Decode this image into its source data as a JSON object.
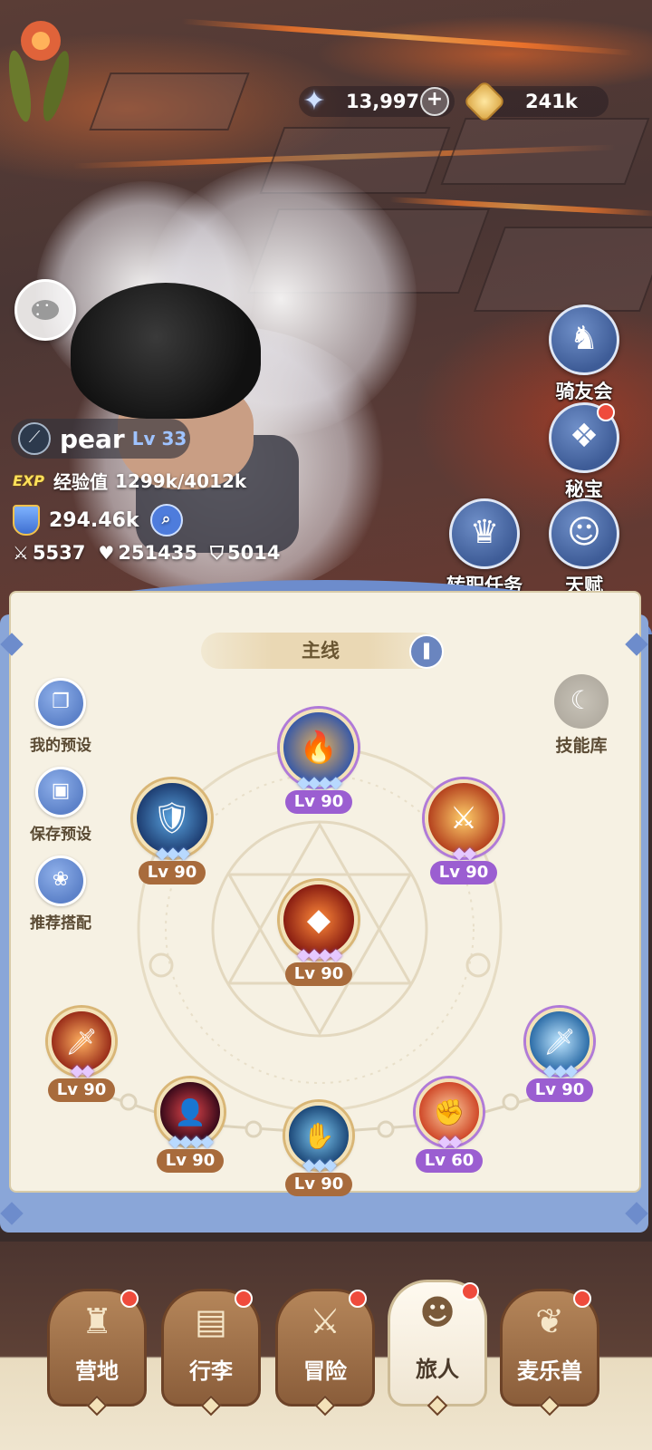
{
  "currency": {
    "gems": "13,997",
    "coins": "241k"
  },
  "player": {
    "name": "pear",
    "level": "Lv 33",
    "exp_badge": "EXP",
    "exp_label": "经验值",
    "exp_value": "1299k/4012k",
    "power": "294.46k",
    "attack": "5537",
    "hp": "251435",
    "defense": "5014"
  },
  "right_menu": {
    "mount_club": "骑友会",
    "treasure": "秘宝",
    "job_change": "转职任务",
    "talent": "天赋"
  },
  "panel": {
    "tab": "主线",
    "my_preset": "我的预设",
    "save_preset": "保存预设",
    "recommended": "推荐搭配",
    "skill_library": "技能库"
  },
  "skills": [
    {
      "id": "top",
      "level": "Lv 90",
      "stars": "◆◆◆◆",
      "icon": "🔥"
    },
    {
      "id": "upper-left",
      "level": "Lv 90",
      "stars": "◆◆◆",
      "icon": "🛡"
    },
    {
      "id": "upper-right",
      "level": "Lv 90",
      "stars": "◆◆",
      "icon": "⚔"
    },
    {
      "id": "center",
      "level": "Lv 90",
      "stars": "◆◆◆◆",
      "icon": "◆"
    },
    {
      "id": "b1",
      "level": "Lv 90",
      "stars": "◆◆",
      "icon": "🗡"
    },
    {
      "id": "b2",
      "level": "Lv 90",
      "stars": "◆◆◆◆",
      "icon": "👤"
    },
    {
      "id": "b3",
      "level": "Lv 90",
      "stars": "◆◆◆",
      "icon": "✋"
    },
    {
      "id": "b4",
      "level": "Lv 60",
      "stars": "◆◆",
      "icon": "✊"
    },
    {
      "id": "b5",
      "level": "Lv 90",
      "stars": "◆◆◆",
      "icon": "🗡"
    }
  ],
  "nav": {
    "camp": "营地",
    "luggage": "行李",
    "adventure": "冒险",
    "traveler": "旅人",
    "pets": "麦乐兽"
  },
  "colors": {
    "accent_blue": "#6d8ccc",
    "notification_red": "#ef4b3c",
    "level_bronze": "#a86b3c",
    "level_purple": "#9b5ed1"
  }
}
